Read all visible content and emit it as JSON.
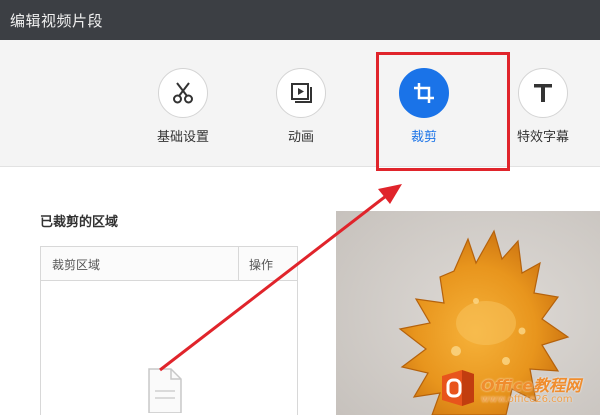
{
  "window": {
    "title": "编辑视频片段"
  },
  "toolbar": {
    "tools": [
      {
        "label": "基础设置",
        "icon": "scissors-icon",
        "active": false
      },
      {
        "label": "动画",
        "icon": "animation-icon",
        "active": false
      },
      {
        "label": "裁剪",
        "icon": "crop-icon",
        "active": true
      },
      {
        "label": "特效字幕",
        "icon": "text-icon",
        "active": false
      }
    ],
    "accent_color": "#1a73e8"
  },
  "crop_panel": {
    "section_title": "已裁剪的区域",
    "table": {
      "columns": [
        "裁剪区域",
        "操作"
      ],
      "rows": []
    },
    "empty_icon": "document-icon"
  },
  "preview": {
    "image": "food-preview"
  },
  "annotation": {
    "highlight_color": "#e0242b"
  },
  "watermark": {
    "brand": "Office教程网",
    "url": "www.office26.com"
  }
}
